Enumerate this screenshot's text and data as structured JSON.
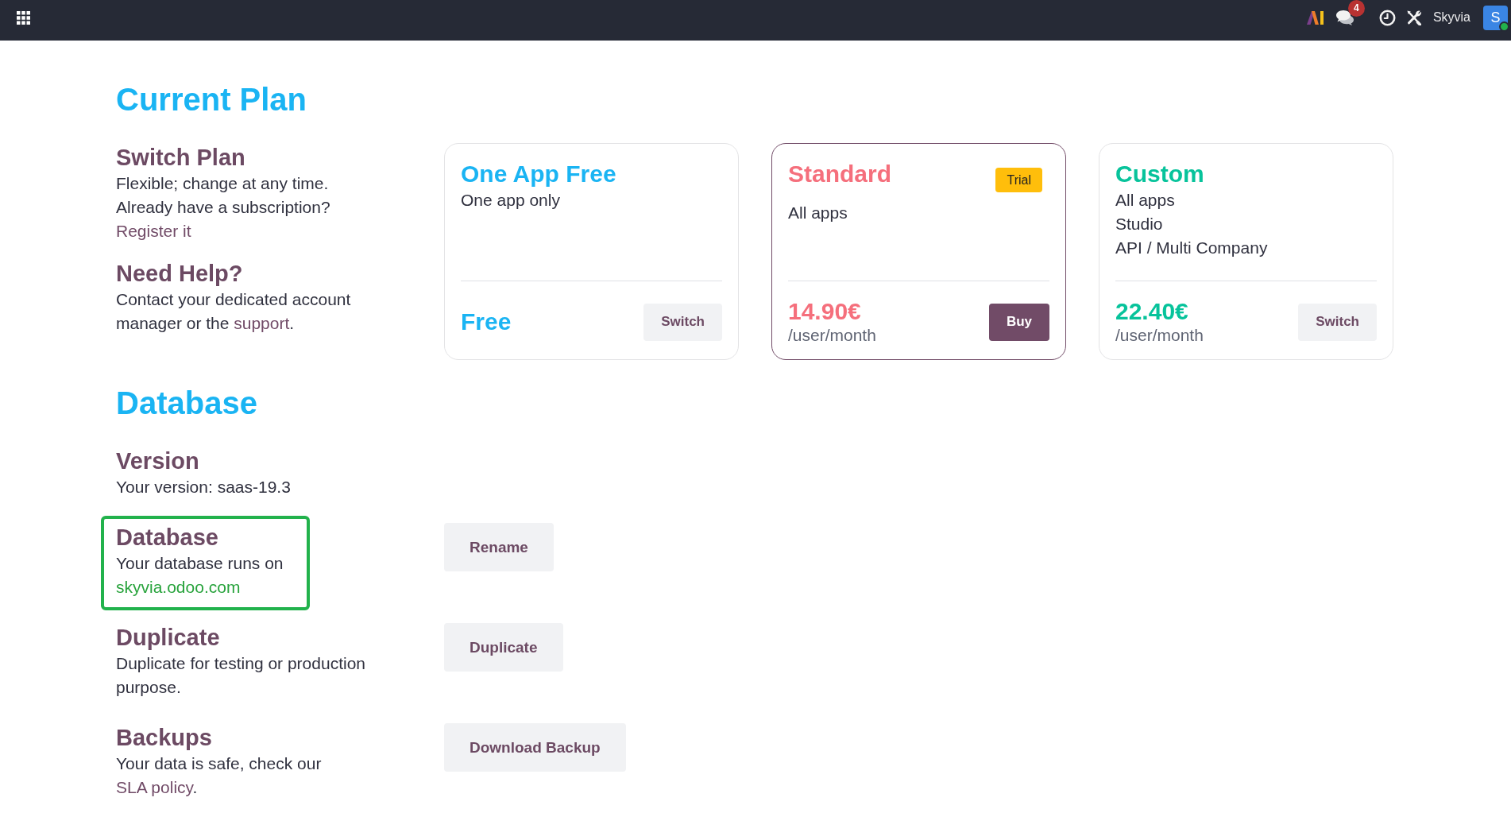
{
  "navbar": {
    "notification_count": "4",
    "company_name": "Skyvia",
    "avatar_initial": "S",
    "user_online": true
  },
  "current_plan": {
    "title": "Current Plan",
    "info": [
      {
        "heading": "Switch Plan",
        "paragraphs": [
          [
            {
              "kind": "text",
              "text": "Flexible; change at any time."
            }
          ],
          [
            {
              "kind": "text",
              "text": "Already have a subscription? "
            },
            {
              "kind": "link",
              "text": "Register it"
            }
          ]
        ]
      },
      {
        "heading": "Need Help?",
        "paragraphs": [
          [
            {
              "kind": "text",
              "text": "Contact your dedicated account manager or the "
            },
            {
              "kind": "link",
              "text": "support"
            },
            {
              "kind": "text",
              "text": "."
            }
          ]
        ]
      }
    ],
    "plans": [
      {
        "name": "One App Free",
        "color": "#1ab4f3",
        "selected": false,
        "features": [
          "One app only"
        ],
        "price": "Free",
        "button": "Switch"
      },
      {
        "name": "Standard",
        "color": "#f56f7c",
        "selected": true,
        "badge": "Trial",
        "features": [
          "All apps"
        ],
        "price": "14.90€",
        "period": "/user/month",
        "button": "Buy"
      },
      {
        "name": "Custom",
        "color": "#07c39b",
        "selected": false,
        "features": [
          "All apps",
          "Studio",
          "API / Multi Company"
        ],
        "price": "22.40€",
        "period": "/user/month",
        "button": "Switch"
      }
    ]
  },
  "database": {
    "title": "Database",
    "items": [
      {
        "heading": "Version",
        "highlighted": false,
        "paragraphs": [
          [
            {
              "kind": "text",
              "text": "Your version: saas-19.3"
            }
          ]
        ]
      },
      {
        "heading": "Database",
        "highlighted": true,
        "paragraphs": [
          [
            {
              "kind": "text",
              "text": "Your database runs on "
            },
            {
              "kind": "link",
              "text": "skyvia.odoo.com"
            }
          ]
        ],
        "button": "Rename"
      },
      {
        "heading": "Duplicate",
        "highlighted": false,
        "paragraphs": [
          [
            {
              "kind": "text",
              "text": "Duplicate for testing or production purpose."
            }
          ]
        ],
        "button": "Duplicate"
      },
      {
        "heading": "Backups",
        "highlighted": false,
        "paragraphs": [
          [
            {
              "kind": "text",
              "text": "Your data is safe, check our "
            },
            {
              "kind": "link",
              "text": "SLA policy"
            },
            {
              "kind": "text",
              "text": "."
            }
          ]
        ],
        "button": "Download Backup"
      }
    ]
  }
}
